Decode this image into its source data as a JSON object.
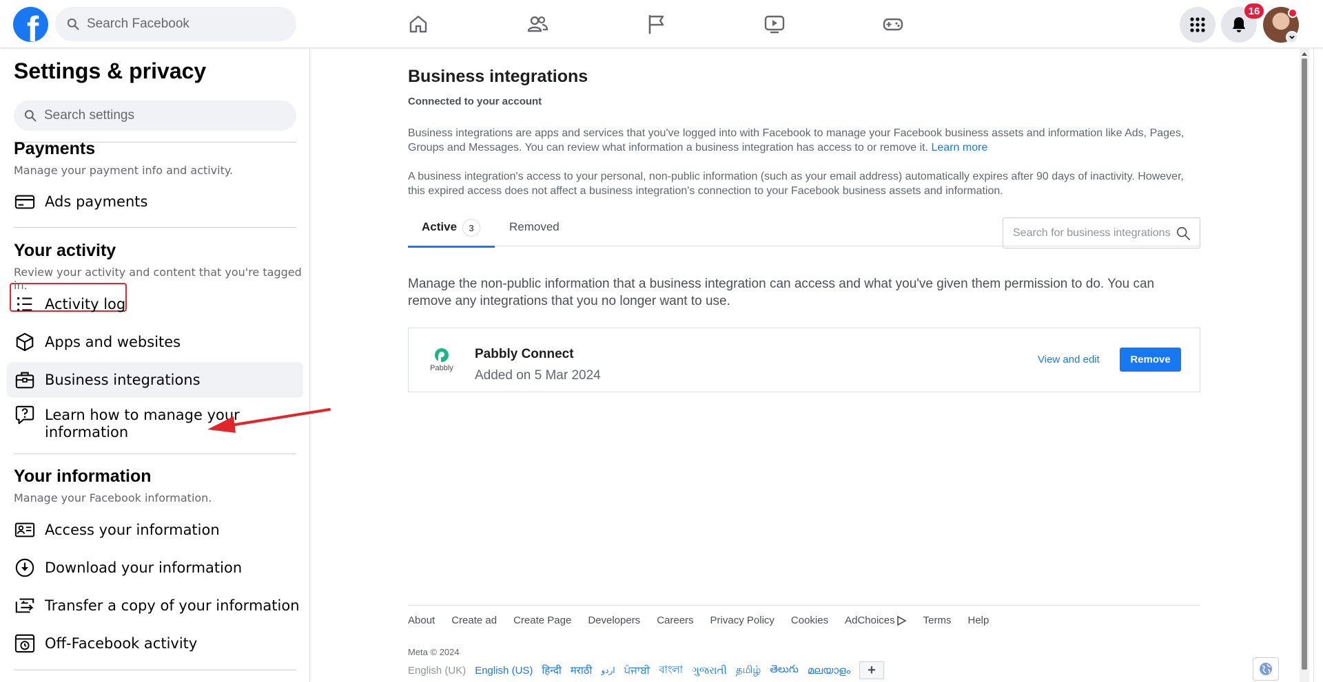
{
  "topbar": {
    "logo_letter": "f",
    "search_placeholder": "Search Facebook",
    "notification_count": "16",
    "colors": {
      "brand": "#1877f2",
      "badge": "#e41e3f"
    },
    "nav_icons": [
      "home-icon",
      "friends-icon",
      "pages-flag-icon",
      "watch-video-icon",
      "gaming-icon"
    ]
  },
  "sidebar": {
    "title": "Settings & privacy",
    "search_placeholder": "Search settings",
    "payments": {
      "title": "Payments",
      "subtitle": "Manage your payment info and activity.",
      "items": [
        {
          "label": "Ads payments",
          "icon": "credit-card-icon"
        }
      ]
    },
    "activity": {
      "title": "Your activity",
      "subtitle": "Review your activity and content that you're tagged in.",
      "items": [
        {
          "label": "Activity log",
          "icon": "list-icon"
        },
        {
          "label": "Apps and websites",
          "icon": "cube-icon"
        },
        {
          "label": "Business integrations",
          "icon": "briefcase-icon",
          "active": true
        },
        {
          "label": "Learn how to manage your information",
          "icon": "help-chat-icon"
        }
      ]
    },
    "information": {
      "title": "Your information",
      "subtitle": "Manage your Facebook information.",
      "items": [
        {
          "label": "Access your information",
          "icon": "id-card-icon"
        },
        {
          "label": "Download your information",
          "icon": "download-icon"
        },
        {
          "label": "Transfer a copy of your information",
          "icon": "transfer-icon"
        },
        {
          "label": "Off-Facebook activity",
          "icon": "history-icon"
        }
      ]
    }
  },
  "main": {
    "title": "Business integrations",
    "subtitle": "Connected to your account",
    "para1": "Business integrations are apps and services that you've logged into with Facebook to manage your Facebook business assets and information like Ads, Pages, Groups and Messages. You can review what information a business integration has access to or remove it.",
    "learn_more": "Learn more",
    "para2": "A business integration's access to your personal, non-public information (such as your email address) automatically expires after 90 days of inactivity. However, this expired access does not affect a business integration's connection to your Facebook business assets and information.",
    "tabs": [
      {
        "label": "Active",
        "count": "3",
        "active": true
      },
      {
        "label": "Removed"
      }
    ],
    "search_placeholder": "Search for business integrations",
    "manage_text": "Manage the non-public information that a business integration can access and what you've given them permission to do. You can remove any integrations that you no longer want to use.",
    "integration": {
      "logo_text": "Pabbly",
      "name": "Pabbly Connect",
      "added": "Added on 5 Mar 2024",
      "view_edit": "View and edit",
      "remove": "Remove"
    },
    "footer": {
      "links": [
        "About",
        "Create ad",
        "Create Page",
        "Developers",
        "Careers",
        "Privacy Policy",
        "Cookies",
        "AdChoices",
        "Terms",
        "Help"
      ],
      "meta": "Meta © 2024",
      "current_language": "English (UK)",
      "languages": [
        "English (US)",
        "हिन्दी",
        "मराठी",
        "اردو",
        "ਪੰਜਾਬੀ",
        "বাংলা",
        "ગુજરાતી",
        "தமிழ்",
        "తెలుగు",
        "മലയാളം"
      ],
      "more_languages": "+"
    }
  }
}
